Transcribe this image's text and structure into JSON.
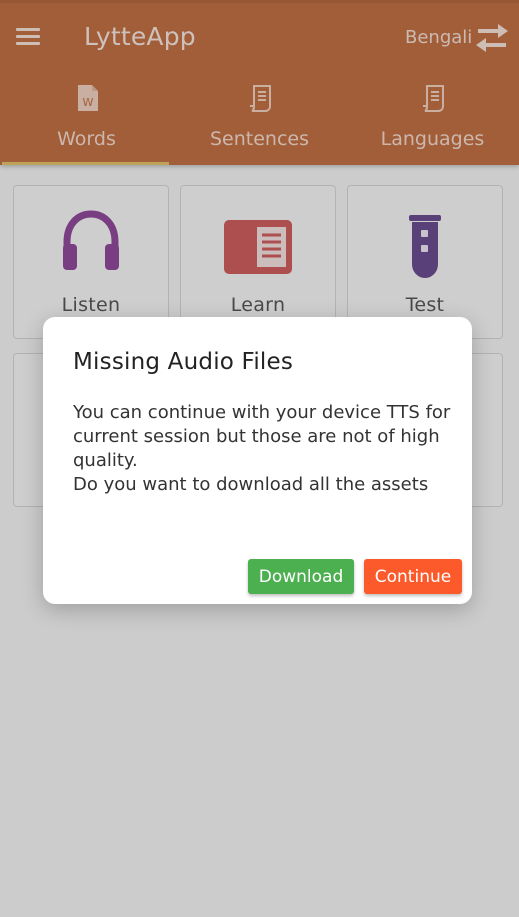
{
  "colors": {
    "brand": "#b6501b",
    "tab_indicator": "#e1b54a",
    "listen_icon": "#7a2387",
    "learn_icon": "#c73b3b",
    "test_icon": "#4a2678",
    "download_button": "#4caf50",
    "continue_button": "#fc5a2a"
  },
  "header": {
    "title": "LytteApp",
    "language": "Bengali",
    "menu_icon": "hamburger-menu-icon",
    "swap_icon": "swap-arrows-icon"
  },
  "tabs": [
    {
      "label": "Words",
      "icon": "word-document-icon",
      "selected": true
    },
    {
      "label": "Sentences",
      "icon": "document-icon",
      "selected": false
    },
    {
      "label": "Languages",
      "icon": "document-icon",
      "selected": false
    }
  ],
  "cards": [
    {
      "label": "Listen",
      "icon": "headphones-icon"
    },
    {
      "label": "Learn",
      "icon": "book-icon"
    },
    {
      "label": "Test",
      "icon": "test-tube-icon"
    }
  ],
  "dialog": {
    "title": "Missing Audio Files",
    "message_line1": "You can continue with your device TTS for current session but those are not of high quality.",
    "message_line2": "Do you want to download all the assets",
    "download_label": "Download",
    "continue_label": "Continue"
  }
}
